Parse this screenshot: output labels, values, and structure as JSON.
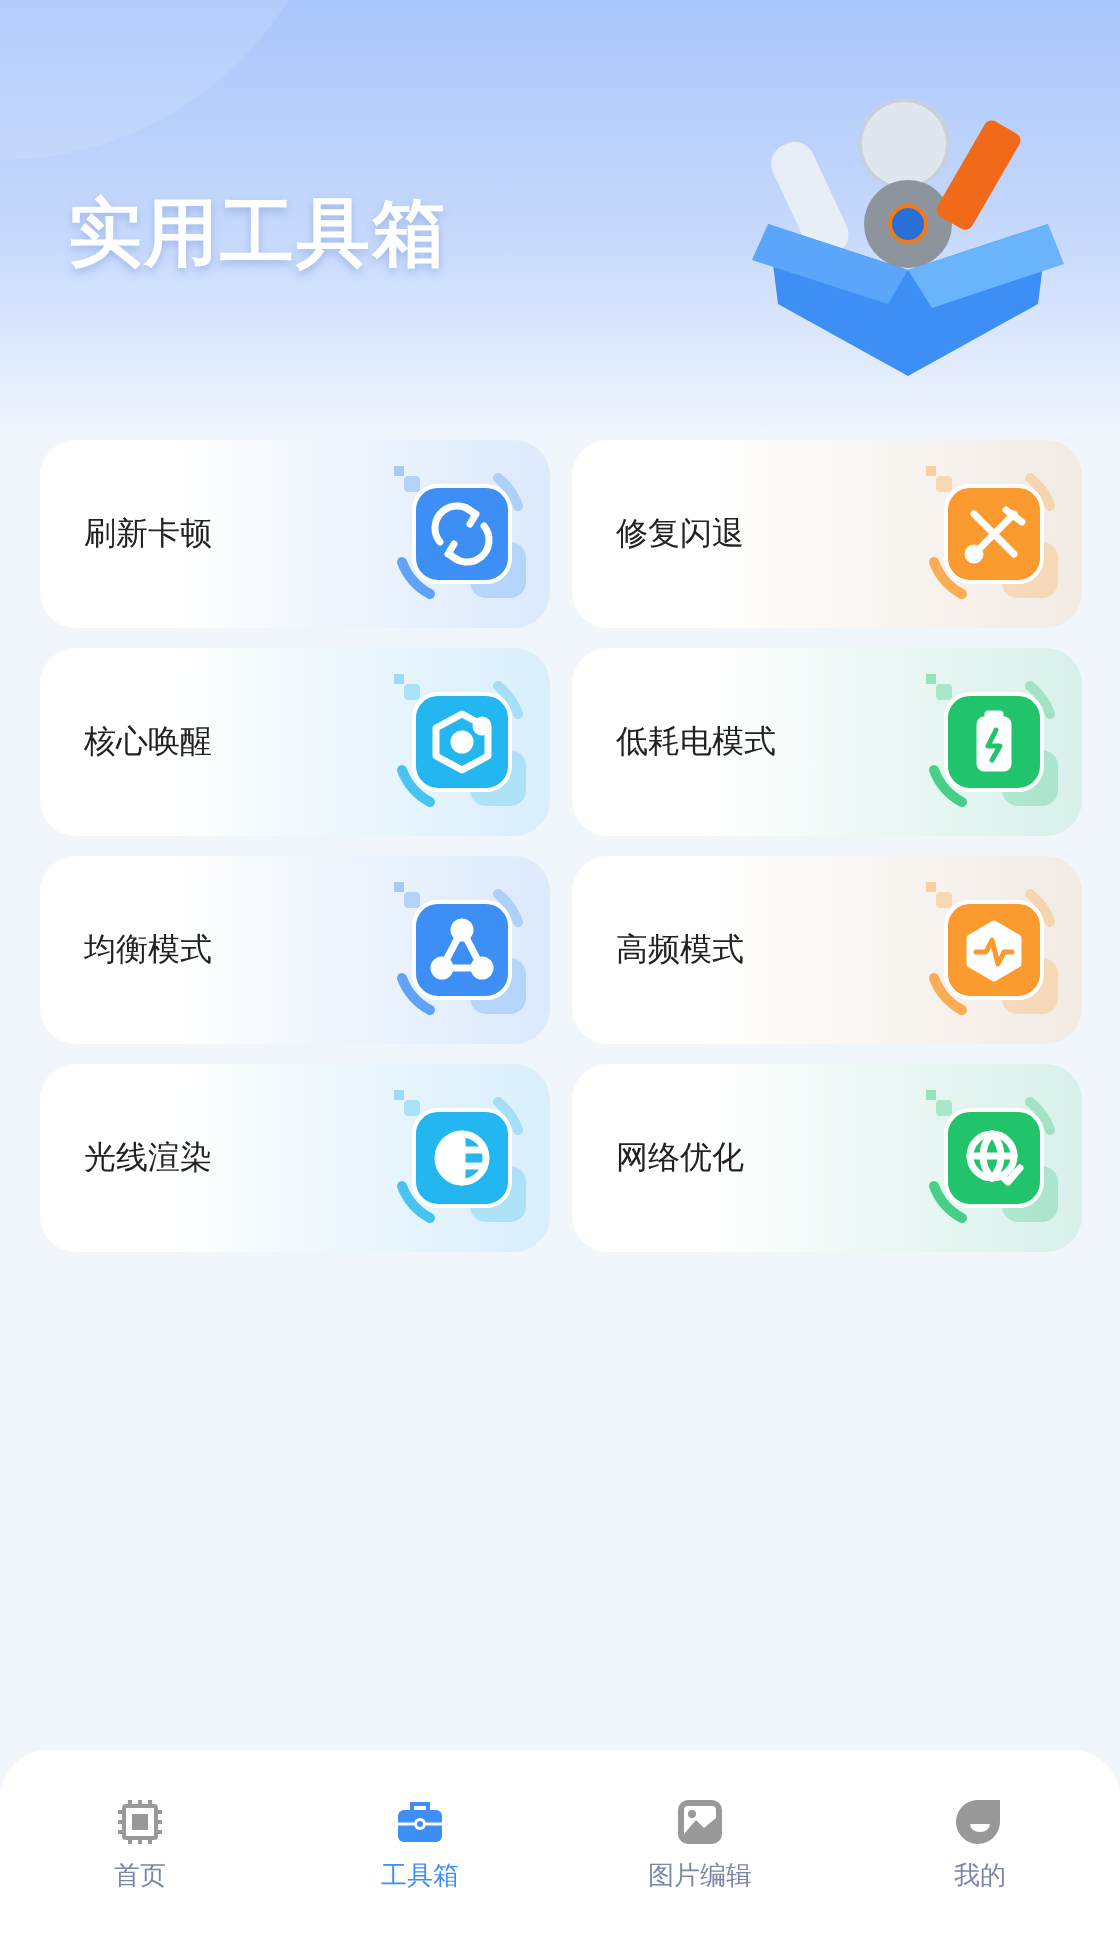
{
  "header": {
    "title": "实用工具箱"
  },
  "tools": [
    {
      "label": "刷新卡顿",
      "kind": "refresh",
      "color": "#3d8ff5"
    },
    {
      "label": "修复闪退",
      "kind": "tools",
      "color": "#fb9a2e"
    },
    {
      "label": "核心唤醒",
      "kind": "core",
      "color": "#23b6f0"
    },
    {
      "label": "低耗电模式",
      "kind": "battery",
      "color": "#21c46a"
    },
    {
      "label": "均衡模式",
      "kind": "triangle",
      "color": "#3d8ff5"
    },
    {
      "label": "高频模式",
      "kind": "pulse",
      "color": "#fb9a2e"
    },
    {
      "label": "光线渲染",
      "kind": "light",
      "color": "#23b6f0"
    },
    {
      "label": "网络优化",
      "kind": "globe",
      "color": "#21c46a"
    }
  ],
  "tab_bar": [
    {
      "label": "首页",
      "kind": "chip",
      "selected": false
    },
    {
      "label": "工具箱",
      "kind": "toolbox",
      "selected": true
    },
    {
      "label": "图片编辑",
      "kind": "image",
      "selected": false
    },
    {
      "label": "我的",
      "kind": "face",
      "selected": false
    }
  ]
}
